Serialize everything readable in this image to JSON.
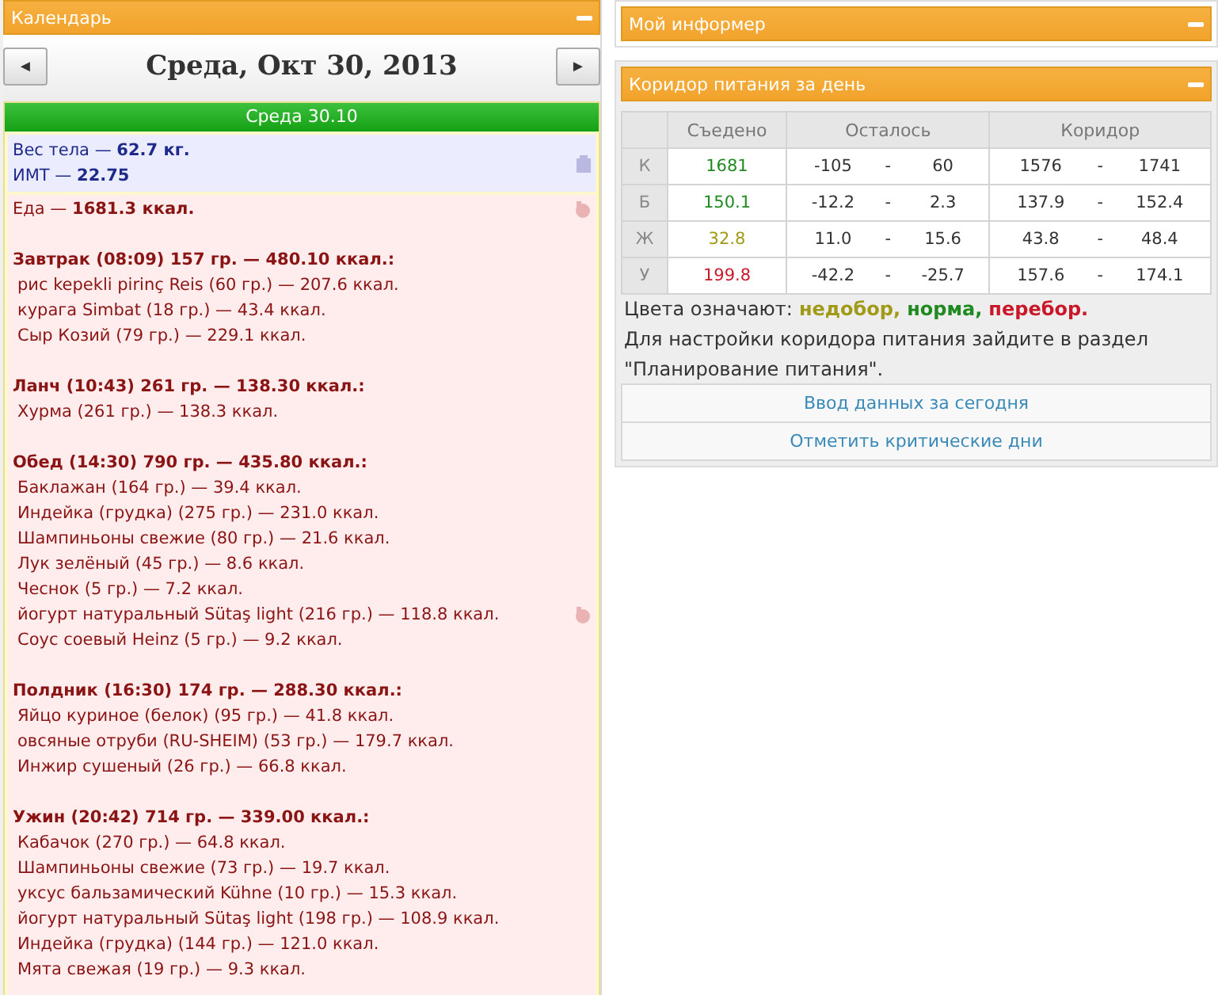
{
  "calendar": {
    "title": "Календарь",
    "date": "Среда, Окт 30, 2013",
    "prev": "◄",
    "next": "►",
    "day_header": "Среда 30.10",
    "body": [
      "Вес тела — **62.7 кг.**",
      "ИМТ — **22.75**"
    ],
    "food_total": "Еда — **1681.3 ккал.**",
    "meals": [
      {
        "title": "Завтрак (08:09) 157 гр. — 480.10 ккал.:",
        "items": [
          {
            "text": "рис kepekli pirinç Reis (60 гр.) — 207.6 ккал.",
            "pinned": false
          },
          {
            "text": "курага Simbat (18 гр.) — 43.4 ккал.",
            "pinned": false
          },
          {
            "text": "Сыр Козий (79 гр.) — 229.1 ккал.",
            "pinned": false
          }
        ]
      },
      {
        "title": "Ланч (10:43) 261 гр. — 138.30 ккал.:",
        "items": [
          {
            "text": "Хурма (261 гр.) — 138.3 ккал.",
            "pinned": false
          }
        ]
      },
      {
        "title": "Обед (14:30) 790 гр. — 435.80 ккал.:",
        "items": [
          {
            "text": "Баклажан (164 гр.) — 39.4 ккал.",
            "pinned": false
          },
          {
            "text": "Индейка (грудка) (275 гр.) — 231.0 ккал.",
            "pinned": false
          },
          {
            "text": "Шампиньоны свежие (80 гр.) — 21.6 ккал.",
            "pinned": false
          },
          {
            "text": "Лук зелёный (45 гр.) — 8.6 ккал.",
            "pinned": false
          },
          {
            "text": "Чеснок (5 гр.) — 7.2 ккал.",
            "pinned": false
          },
          {
            "text": "йогурт натуральный Sütaş light (216 гр.) — 118.8 ккал.",
            "pinned": true
          },
          {
            "text": "Соус соевый Heinz (5 гр.) — 9.2 ккал.",
            "pinned": false
          }
        ]
      },
      {
        "title": "Полдник (16:30) 174 гр. — 288.30 ккал.:",
        "items": [
          {
            "text": "Яйцо куриное (белок) (95 гр.) — 41.8 ккал.",
            "pinned": false
          },
          {
            "text": "овсяные отруби (RU-SHEIM) (53 гр.) — 179.7 ккал.",
            "pinned": false
          },
          {
            "text": "Инжир сушеный (26 гр.) — 66.8 ккал.",
            "pinned": false
          }
        ]
      },
      {
        "title": "Ужин (20:42) 714 гр. — 339.00 ккал.:",
        "items": [
          {
            "text": "Кабачок (270 гр.) — 64.8 ккал.",
            "pinned": false
          },
          {
            "text": "Шампиньоны свежие (73 гр.) — 19.7 ккал.",
            "pinned": false
          },
          {
            "text": "уксус бальзамический Kühne (10 гр.) — 15.3 ккал.",
            "pinned": false
          },
          {
            "text": "йогурт натуральный Sütaş light (198 гр.) — 108.9 ккал.",
            "pinned": false
          },
          {
            "text": "Индейка (грудка) (144 гр.) — 121.0 ккал.",
            "pinned": false
          },
          {
            "text": "Мята свежая (19 гр.) — 9.3 ккал.",
            "pinned": false
          }
        ]
      }
    ]
  },
  "informer": {
    "title": "Мой информер"
  },
  "corridor": {
    "title": "Коридор питания за день",
    "columns": [
      "Съедено",
      "Осталось",
      "Коридор"
    ],
    "rows": [
      {
        "label": "К",
        "eaten": "1681",
        "color": "#1f8a1f",
        "remain_min": "-105",
        "remain_max": "60",
        "corr_min": "1576",
        "corr_max": "1741"
      },
      {
        "label": "Б",
        "eaten": "150.1",
        "color": "#1f8a1f",
        "remain_min": "-12.2",
        "remain_max": "2.3",
        "corr_min": "137.9",
        "corr_max": "152.4"
      },
      {
        "label": "Ж",
        "eaten": "32.8",
        "color": "#a09a18",
        "remain_min": "11.0",
        "remain_max": "15.6",
        "corr_min": "43.8",
        "corr_max": "48.4"
      },
      {
        "label": "У",
        "eaten": "199.8",
        "color": "#c8182a",
        "remain_min": "-42.2",
        "remain_max": "-25.7",
        "corr_min": "157.6",
        "corr_max": "174.1"
      }
    ],
    "sep": "-",
    "legend_label": "Цвета означают:",
    "legend": [
      {
        "text": "недобор,",
        "color": "#a09a18"
      },
      {
        "text": "норма,",
        "color": "#1f8a1f"
      },
      {
        "text": "перебор.",
        "color": "#c8182a"
      }
    ],
    "note": "Для настройки коридора питания зайдите в раздел \"Планирование питания\".",
    "buttons": [
      "Ввод данных за сегодня",
      "Отметить критические дни"
    ]
  }
}
